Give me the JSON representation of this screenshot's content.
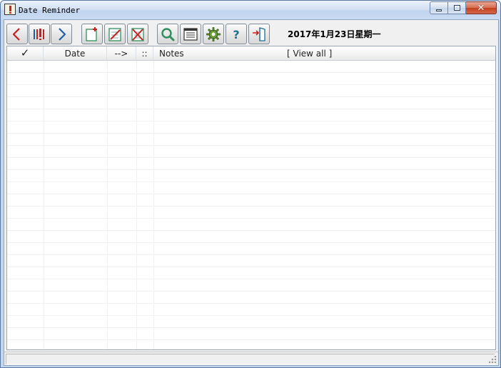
{
  "window": {
    "title": "Date Reminder",
    "controls": {
      "minimize": "minimize",
      "maximize": "maximize",
      "close": "close"
    }
  },
  "toolbar": {
    "buttons": [
      {
        "id": "previous",
        "icon": "chevron-left-icon"
      },
      {
        "id": "today",
        "icon": "today-bars-icon"
      },
      {
        "id": "next",
        "icon": "chevron-right-icon"
      },
      {
        "id": "new",
        "icon": "new-document-icon"
      },
      {
        "id": "edit",
        "icon": "edit-document-icon"
      },
      {
        "id": "delete",
        "icon": "delete-document-icon"
      },
      {
        "id": "search",
        "icon": "magnifier-icon"
      },
      {
        "id": "list",
        "icon": "list-view-icon"
      },
      {
        "id": "settings",
        "icon": "gear-icon"
      },
      {
        "id": "help",
        "icon": "question-icon"
      },
      {
        "id": "exit",
        "icon": "exit-door-icon"
      }
    ],
    "date_label": "2017年1月23日星期一"
  },
  "list": {
    "columns": {
      "check": "✓",
      "date": "Date",
      "arrow": "-->",
      "colon": "::",
      "notes": "Notes"
    },
    "view_all": "[ View all ]",
    "rows": []
  },
  "statusbar": {
    "text": ""
  },
  "colors": {
    "accent_red": "#c62020",
    "accent_green": "#2f8f5f",
    "accent_blue": "#1e5fa8"
  }
}
